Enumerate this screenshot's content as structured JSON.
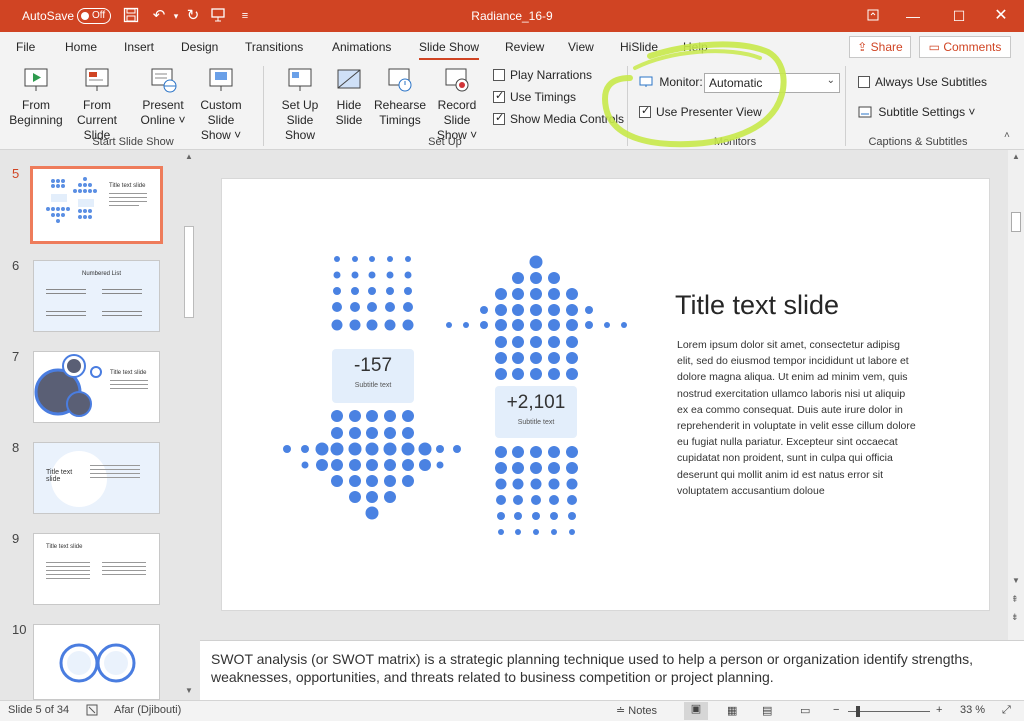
{
  "window": {
    "autosave_label": "AutoSave",
    "autosave_state": "Off",
    "title": "Radiance_16-9"
  },
  "tabs": [
    {
      "label": "File"
    },
    {
      "label": "Home"
    },
    {
      "label": "Insert"
    },
    {
      "label": "Design"
    },
    {
      "label": "Transitions"
    },
    {
      "label": "Animations"
    },
    {
      "label": "Slide Show"
    },
    {
      "label": "Review"
    },
    {
      "label": "View"
    },
    {
      "label": "HiSlide"
    },
    {
      "label": "Help"
    }
  ],
  "active_tab": "Slide Show",
  "share_label": "Share",
  "comments_label": "Comments",
  "ribbon": {
    "start": {
      "from_beginning": [
        "From",
        "Beginning"
      ],
      "from_current": [
        "From",
        "Current Slide"
      ],
      "present_online": [
        "Present",
        "Online ˅"
      ],
      "custom_slide_show": [
        "Custom Slide",
        "Show ˅"
      ],
      "group_label": "Start Slide Show"
    },
    "setup": {
      "setup_slide_show": [
        "Set Up",
        "Slide Show"
      ],
      "hide_slide": [
        "Hide",
        "Slide"
      ],
      "rehearse_timings": [
        "Rehearse",
        "Timings"
      ],
      "record_slide_show": [
        "Record Slide",
        "Show ˅"
      ],
      "play_narrations": {
        "label": "Play Narrations",
        "checked": false
      },
      "use_timings": {
        "label": "Use Timings",
        "checked": true
      },
      "show_media_controls": {
        "label": "Show Media Controls",
        "checked": true
      },
      "group_label": "Set Up"
    },
    "monitors": {
      "monitor_label": "Monitor:",
      "monitor_value": "Automatic",
      "use_presenter_view": {
        "label": "Use Presenter View",
        "checked": true
      },
      "group_label": "Monitors"
    },
    "captions": {
      "always_use_subtitles": {
        "label": "Always Use Subtitles",
        "checked": false
      },
      "subtitle_settings": "Subtitle Settings ˅",
      "group_label": "Captions & Subtitles"
    }
  },
  "thumbnails": [
    {
      "num": "5",
      "title": "Title text slide",
      "active": true
    },
    {
      "num": "6",
      "title": "Numbered List",
      "active": false
    },
    {
      "num": "7",
      "title": "Title text slide",
      "active": false
    },
    {
      "num": "8",
      "title": "Title text slide",
      "active": false
    },
    {
      "num": "9",
      "title": "Title text slide",
      "active": false
    },
    {
      "num": "10",
      "title": "",
      "active": false
    }
  ],
  "slide": {
    "title": "Title text slide",
    "body": "Lorem ipsum dolor sit amet, consectetur adipisg elit, sed do eiusmod tempor incididunt ut labore et dolore magna aliqua. Ut enim ad minim vem, quis nostrud exercitation ullamco laboris nisi ut aliquip ex ea commo consequat. Duis aute irure dolor in reprehenderit in voluptate in velit esse cillum dolore eu fugiat nulla pariatur. Excepteur sint occaecat cupidatat non proident, sunt in culpa qui officia deserunt qui mollit anim id est natus error sit voluptatem accusantium doloue",
    "stat_down": {
      "value": "-157",
      "subtitle": "Subtitle text"
    },
    "stat_up": {
      "value": "+2,101",
      "subtitle": "Subtitle text"
    },
    "accent_color": "#4a82e2"
  },
  "notes": "SWOT analysis (or SWOT matrix) is a strategic planning technique used to help a person or organization identify strengths, weaknesses, opportunities, and threats related to business competition or project planning.",
  "status": {
    "slide_counter": "Slide 5 of 34",
    "language": "Afar (Djibouti)",
    "notes_label": "Notes",
    "zoom": "33 %"
  }
}
